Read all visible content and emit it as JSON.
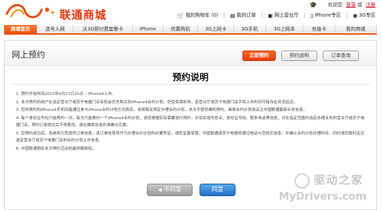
{
  "header": {
    "logo_text": "联通商城",
    "greeting": "欢迎您",
    "login": "登录",
    "or": "或",
    "register": "注册",
    "links": [
      {
        "icon": "cart-icon",
        "glyph": "🛒",
        "label": "我的购物车 (0)"
      },
      {
        "icon": "order-icon",
        "glyph": "▤",
        "label": "我的订单"
      },
      {
        "icon": "store-icon",
        "glyph": "▣",
        "label": "网上营业厅"
      },
      {
        "icon": "iphone-icon",
        "glyph": "▯",
        "label": "iPhone专区"
      },
      {
        "icon": "3g-icon",
        "glyph": "◉",
        "label": "3G专区"
      }
    ]
  },
  "nav": {
    "tabs": [
      {
        "label": "商城首页",
        "active": true
      },
      {
        "label": "选号入网",
        "active": false
      },
      {
        "label": "沃3G预付费套餐卡",
        "active": false
      },
      {
        "label": "iPhone",
        "active": false
      },
      {
        "label": "优惠购机",
        "active": false
      },
      {
        "label": "3G上网卡",
        "active": false
      },
      {
        "label": "3G手机",
        "active": false
      },
      {
        "label": "3G上网本",
        "active": false
      },
      {
        "label": "充值卡",
        "active": false
      },
      {
        "label": "我的商城",
        "active": false
      }
    ]
  },
  "page": {
    "title": "网上预约",
    "buttons": {
      "reserve_now": "立即预约",
      "reserve_info": "预约说明",
      "order_query": "订单查询"
    },
    "doc_title": "预约说明",
    "rules": [
      "1. 预约开始时间2010年9月17日10点 – iPhone4上市。",
      "2. 本次预约的用户在选定营业厅或苏宁电器门店有机会优先购买到iPhone4合约计划。但受资源影响，各营业厅或苏宁电器门店手机上市时间可能存在到货延迟。",
      "3. 您所预约的iPhone4手机仅能通过参与iPhone合约计划方式购买，请按相关规定办理合约计划。本次不提供裸机预约。具体合约计划请关注中国联通最新业务信息。",
      "4. 每个身份证号码只能预约一次，每次只能预约一个iPhone4合约计划，请您根据实际需要进行预约，并如实填写姓名、身份证号码、联系电话等信息，并在指定范围内选定办理业务的营业厅或苏宁电器门店。预约订单提交后不得更改，请在确保信息的准确与完整。",
      "5. 您预约成功后，系统将为您提供订单信息，该订单信息将作为办理合约计划的必要凭证，请您妥善保管。中国联通或苏宁电器将通过电话与您核实信息，并确认合约计划办理时间，同时请您随时关注选定营业厅或苏宁电器门店的合约计划上市信息。",
      "6. 中国联通拥有本次预约活动的最终解释权。"
    ],
    "disagree": "不同意",
    "agree": "同意"
  },
  "watermark": {
    "cn": "驱动之家",
    "en": "MyDrivers.com"
  },
  "colors": {
    "brand_orange": "#e8520f",
    "brand_red": "#e8380d",
    "agree_blue": "#1e6fc4"
  }
}
